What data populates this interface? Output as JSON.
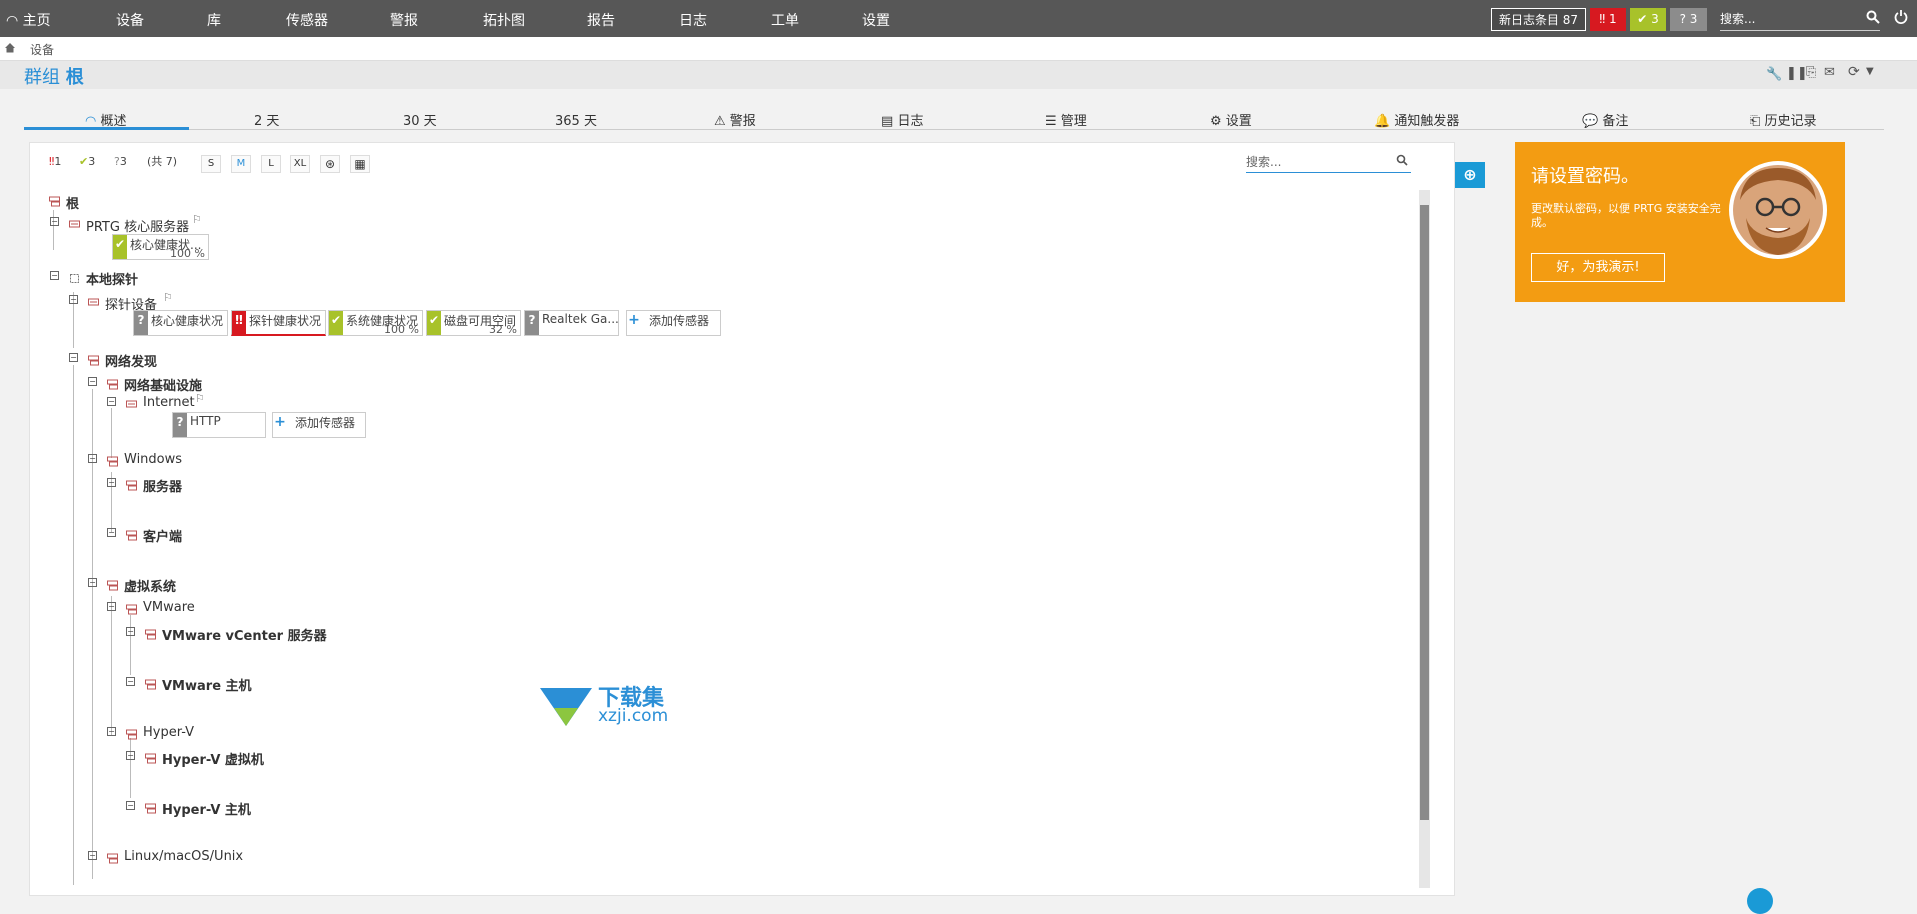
{
  "nav": {
    "home": "主页",
    "items": [
      "设备",
      "库",
      "传感器",
      "警报",
      "拓扑图",
      "报告",
      "日志",
      "工单",
      "设置"
    ],
    "new_log_label": "新日志条目",
    "new_log_count": "87",
    "status": {
      "error": "1",
      "ok": "3",
      "unknown": "3"
    },
    "search_placeholder": "搜索..."
  },
  "breadcrumb": "设备",
  "page_title": {
    "prefix": "群组",
    "name": "根"
  },
  "tabs": [
    "概述",
    "2  天",
    "30  天",
    "365 天",
    "警报",
    "日志",
    "管理",
    "设置",
    "通知触发器",
    "备注",
    "历史记录"
  ],
  "toolbar": {
    "err_count": "1",
    "ok_count": "3",
    "unknown_count": "3",
    "total": "(共 7)",
    "sizes": [
      "S",
      "M",
      "L",
      "XL"
    ],
    "search_placeholder": "搜索..."
  },
  "tree": {
    "root": "根",
    "core_server": "PRTG 核心服务器",
    "local_probe": "本地探针",
    "probe_device": "探针设备",
    "net_discovery": "网络发现",
    "net_infra": "网络基础设施",
    "internet": "Internet",
    "windows": "Windows",
    "servers": "服务器",
    "clients": "客户端",
    "virtual": "虚拟系统",
    "vmware": "VMware",
    "vcenter": "VMware vCenter 服务器",
    "vmware_host": "VMware 主机",
    "hyperv": "Hyper-V",
    "hyperv_vm": "Hyper-V 虚拟机",
    "hyperv_host": "Hyper-V 主机",
    "linux": "Linux/macOS/Unix"
  },
  "sensors": {
    "core_health": {
      "name": "核心健康状...",
      "value": "100 %"
    },
    "probe_sensors": [
      {
        "name": "核心健康状况",
        "value": ""
      },
      {
        "name": "探针健康状况",
        "value": ""
      },
      {
        "name": "系统健康状况",
        "value": "100 %"
      },
      {
        "name": "磁盘可用空间",
        "value": "32 %"
      },
      {
        "name": "Realtek Ga...",
        "value": ""
      }
    ],
    "add_sensor": "添加传感器",
    "http": "HTTP"
  },
  "card": {
    "title": "请设置密码。",
    "text": "更改默认密码，以便 PRTG 安装安全完成。",
    "button": "好，为我演示!"
  },
  "watermark": {
    "cn": "下载集",
    "url": "xzji.com"
  },
  "colors": {
    "error": "#d71920",
    "ok": "#a8c22a",
    "unknown": "#8c8c8c",
    "accent": "#2b8fd6",
    "card": "#f39c12"
  }
}
